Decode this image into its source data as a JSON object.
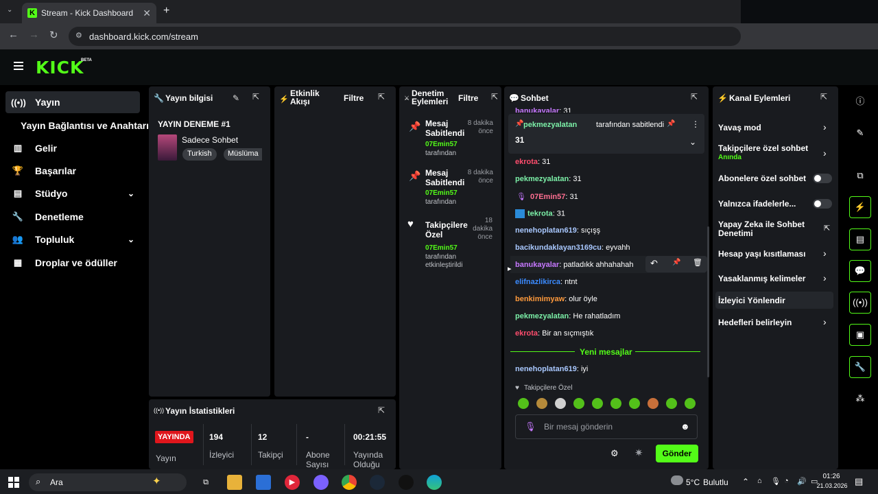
{
  "browser": {
    "tab_title": "Stream - Kick Dashboard",
    "url": "dashboard.kick.com/stream",
    "new_tab": "+",
    "close": "✕"
  },
  "header": {
    "logo": "KICK",
    "badge": "BETA"
  },
  "sidebar": {
    "items": [
      {
        "label": "Yayın",
        "icon": "stream-icon"
      },
      {
        "label": "Yayın Bağlantısı ve Anahtarı"
      },
      {
        "label": "Gelir",
        "icon": "chart-icon"
      },
      {
        "label": "Başarılar",
        "icon": "trophy-icon"
      },
      {
        "label": "Stüdyo",
        "icon": "studio-icon"
      },
      {
        "label": "Denetleme",
        "icon": "wrench-icon"
      },
      {
        "label": "Topluluk",
        "icon": "people-icon"
      },
      {
        "label": "Droplar ve ödüller",
        "icon": "drops-icon"
      }
    ]
  },
  "stream_info": {
    "title": "Yayın bilgisi",
    "stream_name": "YAYIN DENEME #1",
    "category": "Sadece Sohbet",
    "tags": [
      "Turkish",
      "Müslüma"
    ]
  },
  "activity": {
    "title": "Etkinlik Akışı",
    "filter": "Filtre"
  },
  "moderation": {
    "title": "Denetim Eylemleri",
    "filter": "Filtre",
    "events": [
      {
        "title": "Mesaj Sabitlendi",
        "user": "07Emin57",
        "by": "tarafından",
        "time": "8 dakika önce"
      },
      {
        "title": "Mesaj Sabitlendi",
        "user": "07Emin57",
        "by": "tarafından",
        "time": "8 dakika önce"
      },
      {
        "title": "Takipçilere Özel",
        "user": "07Emin57",
        "by": "tarafından etkinleştirildi",
        "time": "18 dakika önce"
      }
    ]
  },
  "stats": {
    "title": "Yayın İstatistikleri",
    "status_badge": "YAYINDA",
    "status_label": "Yayın",
    "items": [
      {
        "value": "194",
        "label": "İzleyici"
      },
      {
        "value": "12",
        "label": "Takipçi"
      },
      {
        "value": "-",
        "label": "Abone Sayısı"
      },
      {
        "value": "00:21:55",
        "label": "Yayında Olduğu"
      }
    ]
  },
  "chat": {
    "title": "Sohbet",
    "pinned": {
      "by_user": "pekmezyalatan",
      "by_text": "tarafından sabitlendi",
      "message": "31"
    },
    "top_user": "banukayalar",
    "top_text": ": 31",
    "messages": [
      {
        "user": "ekrota",
        "text": ": 31",
        "color": "#ff4d6d"
      },
      {
        "user": "pekmezyalatan",
        "text": ": 31",
        "color": "#7cf0a8"
      },
      {
        "user": "07Emin57",
        "text": ": 31",
        "color": "#ff6f91"
      },
      {
        "user": "tekrota",
        "text": ": 31",
        "color": "#7cf0a8"
      },
      {
        "user": "nenehoplatan619",
        "text": ": sıçışş",
        "color": "#a9c8ff"
      },
      {
        "user": "bacikundaklayan3169cu",
        "text": ": eyvahh",
        "color": "#a9c8ff"
      },
      {
        "user": "banukayalar",
        "text": ": patladıkk ahhahahah",
        "color": "#c678ff"
      },
      {
        "user": "elifnazlikirca",
        "text": ": ntnt",
        "color": "#3b8bff"
      },
      {
        "user": "benkimimyaw",
        "text": ": olur öyle",
        "color": "#ff9a3c"
      },
      {
        "user": "pekmezyalatan",
        "text": ": He rahatladım",
        "color": "#7cf0a8"
      },
      {
        "user": "ekrota",
        "text": ": Bir an sıçmıştık",
        "color": "#ff4d6d"
      }
    ],
    "new_divider": "Yeni mesajlar",
    "new_message": {
      "user": "nenehoplatan619",
      "text": ": iyi",
      "color": "#a9c8ff"
    },
    "mode": "Takipçilere Özel",
    "input_placeholder": "Bir mesaj gönderin",
    "send": "Gönder"
  },
  "channel_actions": {
    "title": "Kanal Eylemleri",
    "items": [
      {
        "label": "Yavaş mod"
      },
      {
        "label": "Takipçilere özel sohbet",
        "sub": "Anında"
      },
      {
        "label": "Abonelere özel sohbet"
      },
      {
        "label": "Yalnızca ifadelerle..."
      },
      {
        "label": "Yapay Zeka ile Sohbet Denetimi"
      },
      {
        "label": "Hesap yaşı kısıtlaması"
      },
      {
        "label": "Yasaklanmış kelimeler"
      },
      {
        "label": "İzleyici Yönlendir"
      },
      {
        "label": "Hedefleri belirleyin"
      }
    ]
  },
  "taskbar": {
    "search": "Ara",
    "weather_temp": "5°C",
    "weather_text": "Bulutlu",
    "time": "01:26",
    "date": "21.03.2026"
  },
  "colors": {
    "accent": "#53fc18",
    "panel": "#191b1f",
    "live": "#e0161c"
  }
}
